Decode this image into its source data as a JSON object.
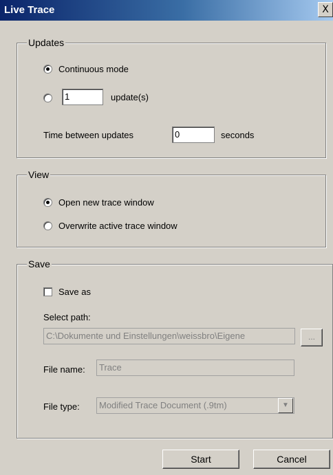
{
  "window": {
    "title": "Live Trace",
    "close_glyph": "X"
  },
  "updates": {
    "legend": "Updates",
    "continuous_label": "Continuous mode",
    "count_value": "1",
    "count_unit": "update(s)",
    "time_label": "Time between updates",
    "time_value": "0",
    "time_unit": "seconds",
    "selected": "continuous"
  },
  "view": {
    "legend": "View",
    "open_new_label": "Open new trace window",
    "overwrite_label": "Overwrite active trace window",
    "selected": "open_new"
  },
  "save": {
    "legend": "Save",
    "save_as_label": "Save as",
    "save_as_checked": false,
    "select_path_label": "Select path:",
    "path_value": "C:\\Dokumente und Einstellungen\\weissbro\\Eigene",
    "browse_label": "...",
    "file_name_label": "File name:",
    "file_name_value": "Trace",
    "file_type_label": "File type:",
    "file_type_value": "Modified Trace Document (.9tm)"
  },
  "buttons": {
    "start": "Start",
    "cancel": "Cancel"
  }
}
